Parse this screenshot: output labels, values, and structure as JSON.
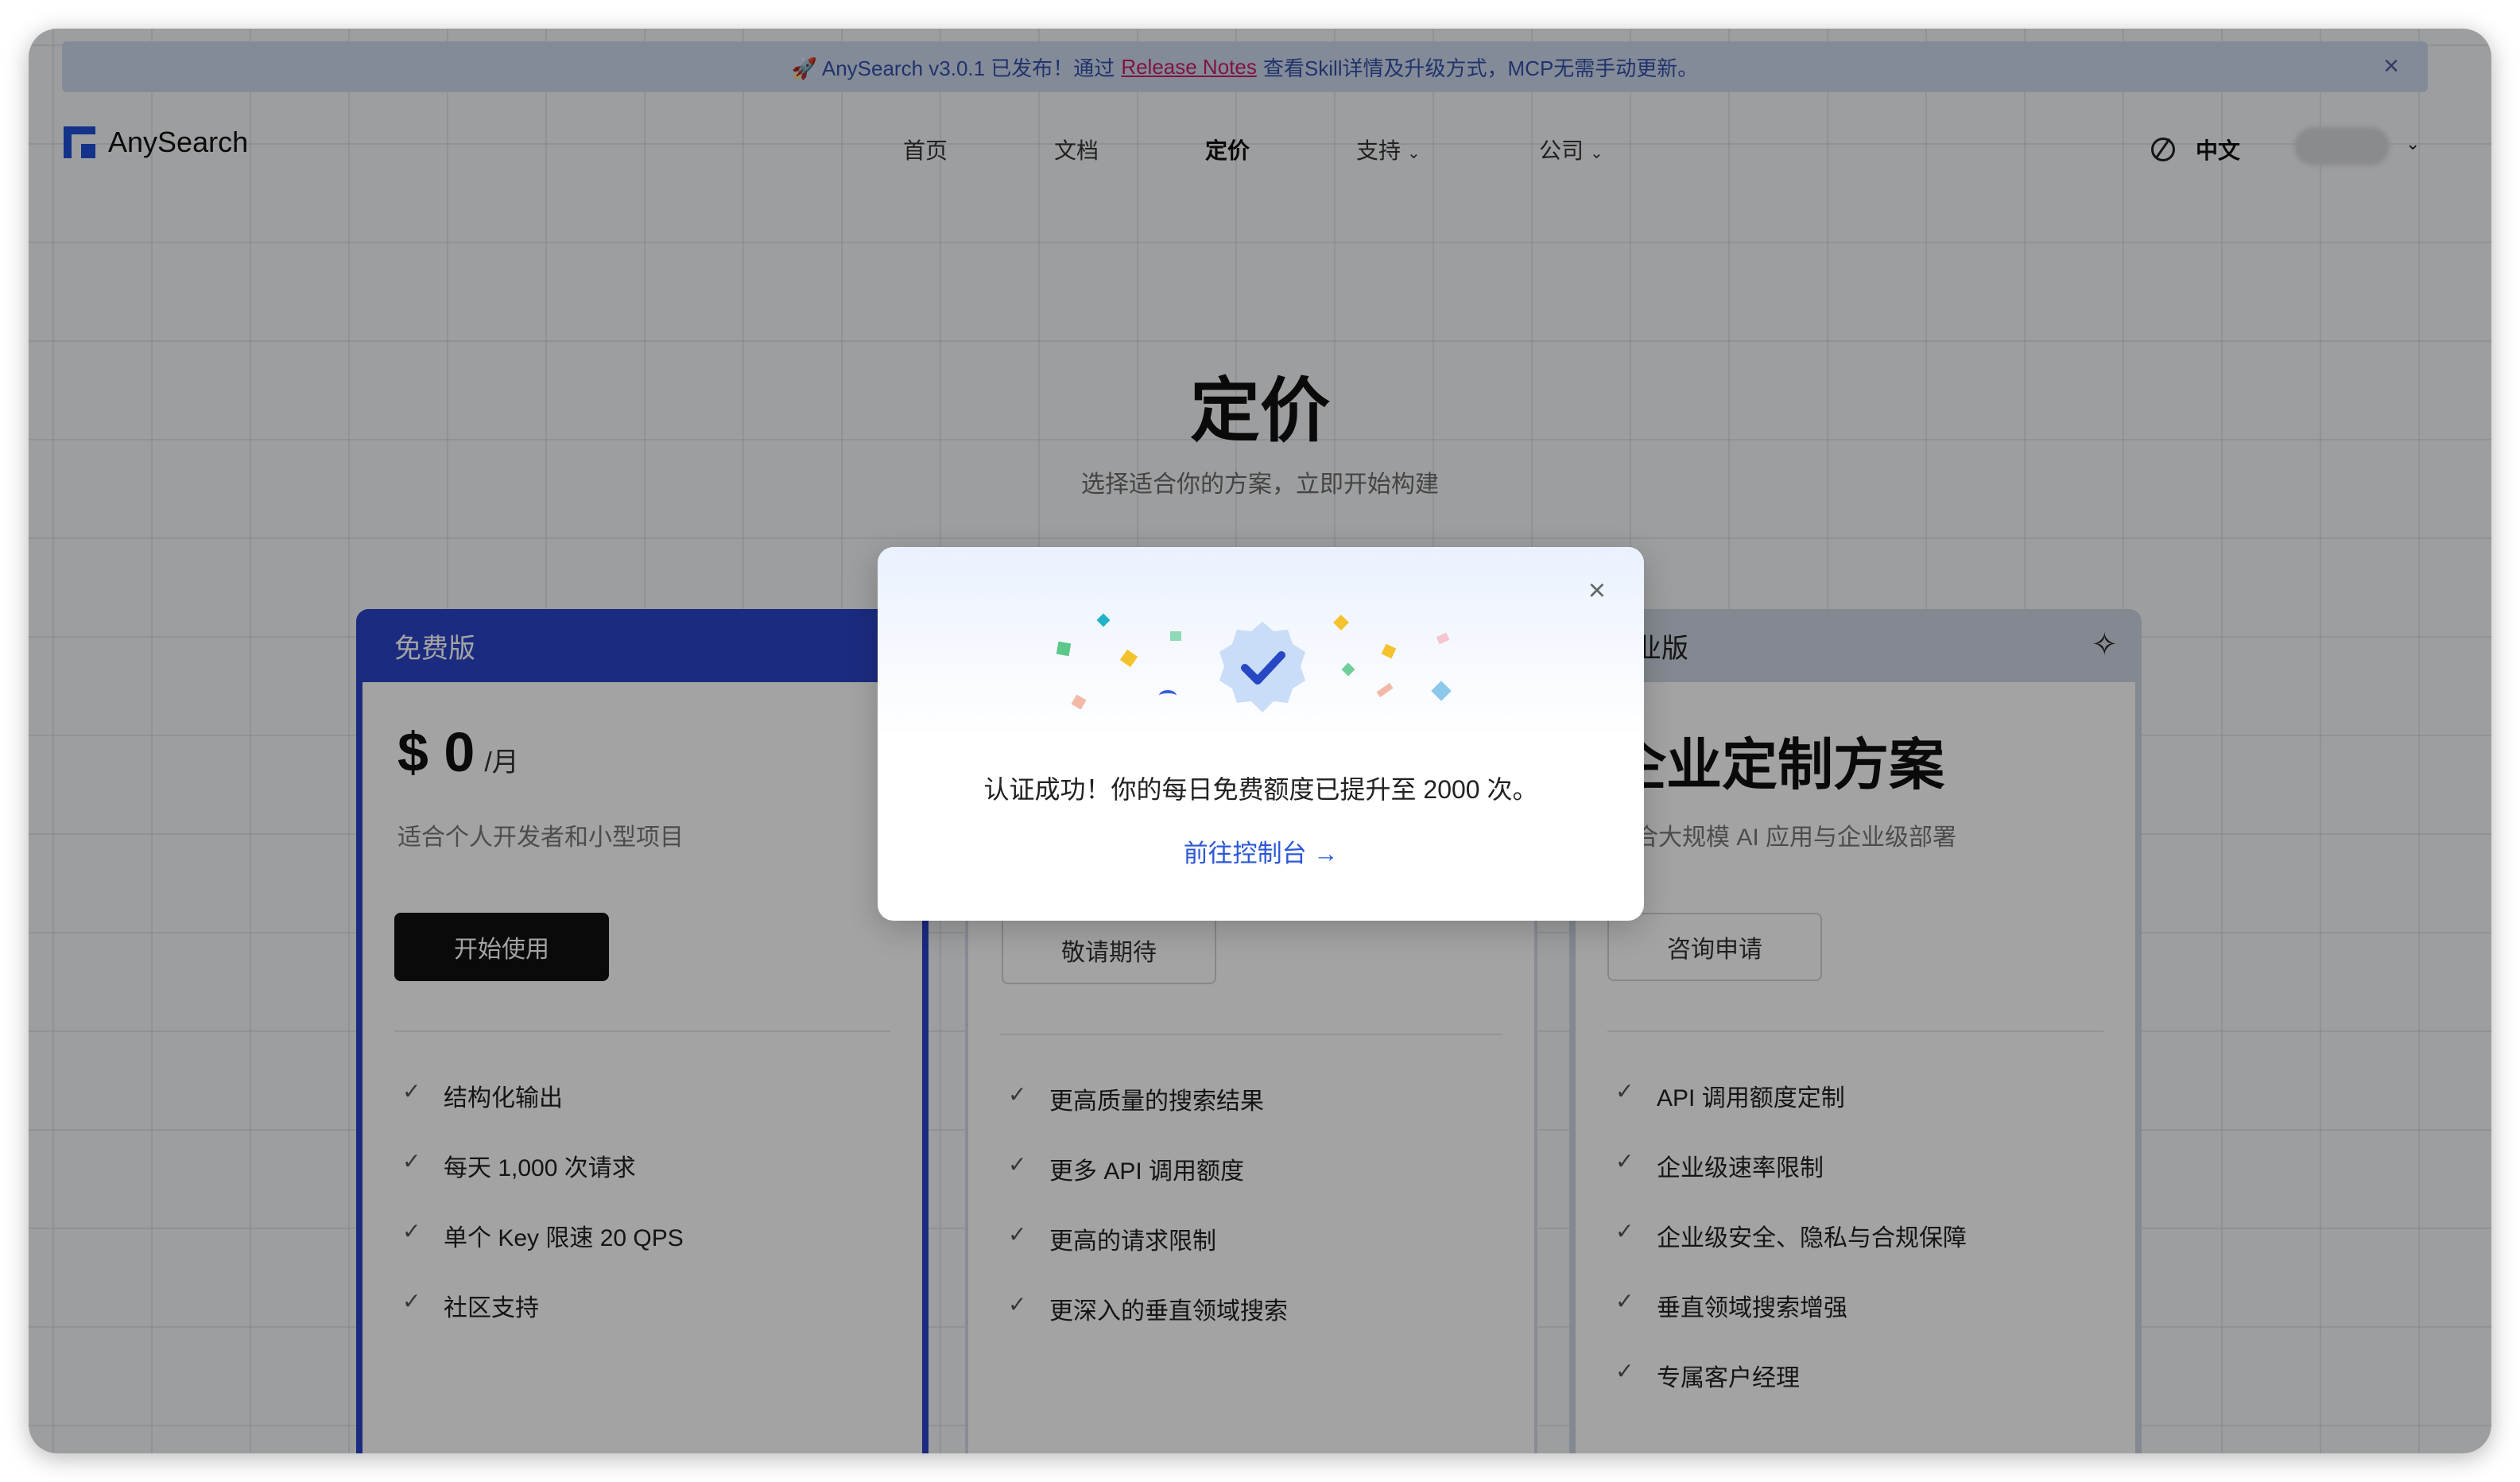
{
  "announcement": {
    "prefix": "🚀 AnySearch v3.0.1 已发布！通过",
    "link": "Release Notes",
    "suffix": "查看Skill详情及升级方式，MCP无需手动更新。",
    "close": "×"
  },
  "nav": {
    "brand": "AnySearch",
    "links": [
      "首页",
      "文档",
      "定价",
      "支持",
      "公司"
    ],
    "chevron": "⌄",
    "language": "中文"
  },
  "hero": {
    "title": "定价",
    "subtitle": "选择适合你的方案，立即开始构建"
  },
  "plans": {
    "free": {
      "name": "免费版",
      "price": "$ 0",
      "unit": "/月",
      "desc": "适合个人开发者和小型项目",
      "button": "开始使用",
      "features": [
        "结构化输出",
        "每天 1,000 次请求",
        "单个 Key 限速 20 QPS",
        "社区支持"
      ]
    },
    "pro": {
      "button": "敬请期待",
      "features": [
        "更高质量的搜索结果",
        "更多 API 调用额度",
        "更高的请求限制",
        "更深入的垂直领域搜索"
      ]
    },
    "enterprise": {
      "name": "企业版",
      "title": "企业定制方案",
      "desc": "适合大规模 AI 应用与企业级部署",
      "button": "咨询申请",
      "features": [
        "API 调用额度定制",
        "企业级速率限制",
        "企业级安全、隐私与合规保障",
        "垂直领域搜索增强",
        "专属客户经理"
      ]
    }
  },
  "modal": {
    "message": "认证成功！你的每日免费额度已提升至 2000 次。",
    "cta": "前往控制台 →",
    "close": "×"
  },
  "icons": {
    "check": "✓",
    "sparkle": "✧"
  },
  "colors": {
    "primary": "#2b44c9",
    "link": "#2b57d8",
    "announce_link": "#c81e66"
  }
}
